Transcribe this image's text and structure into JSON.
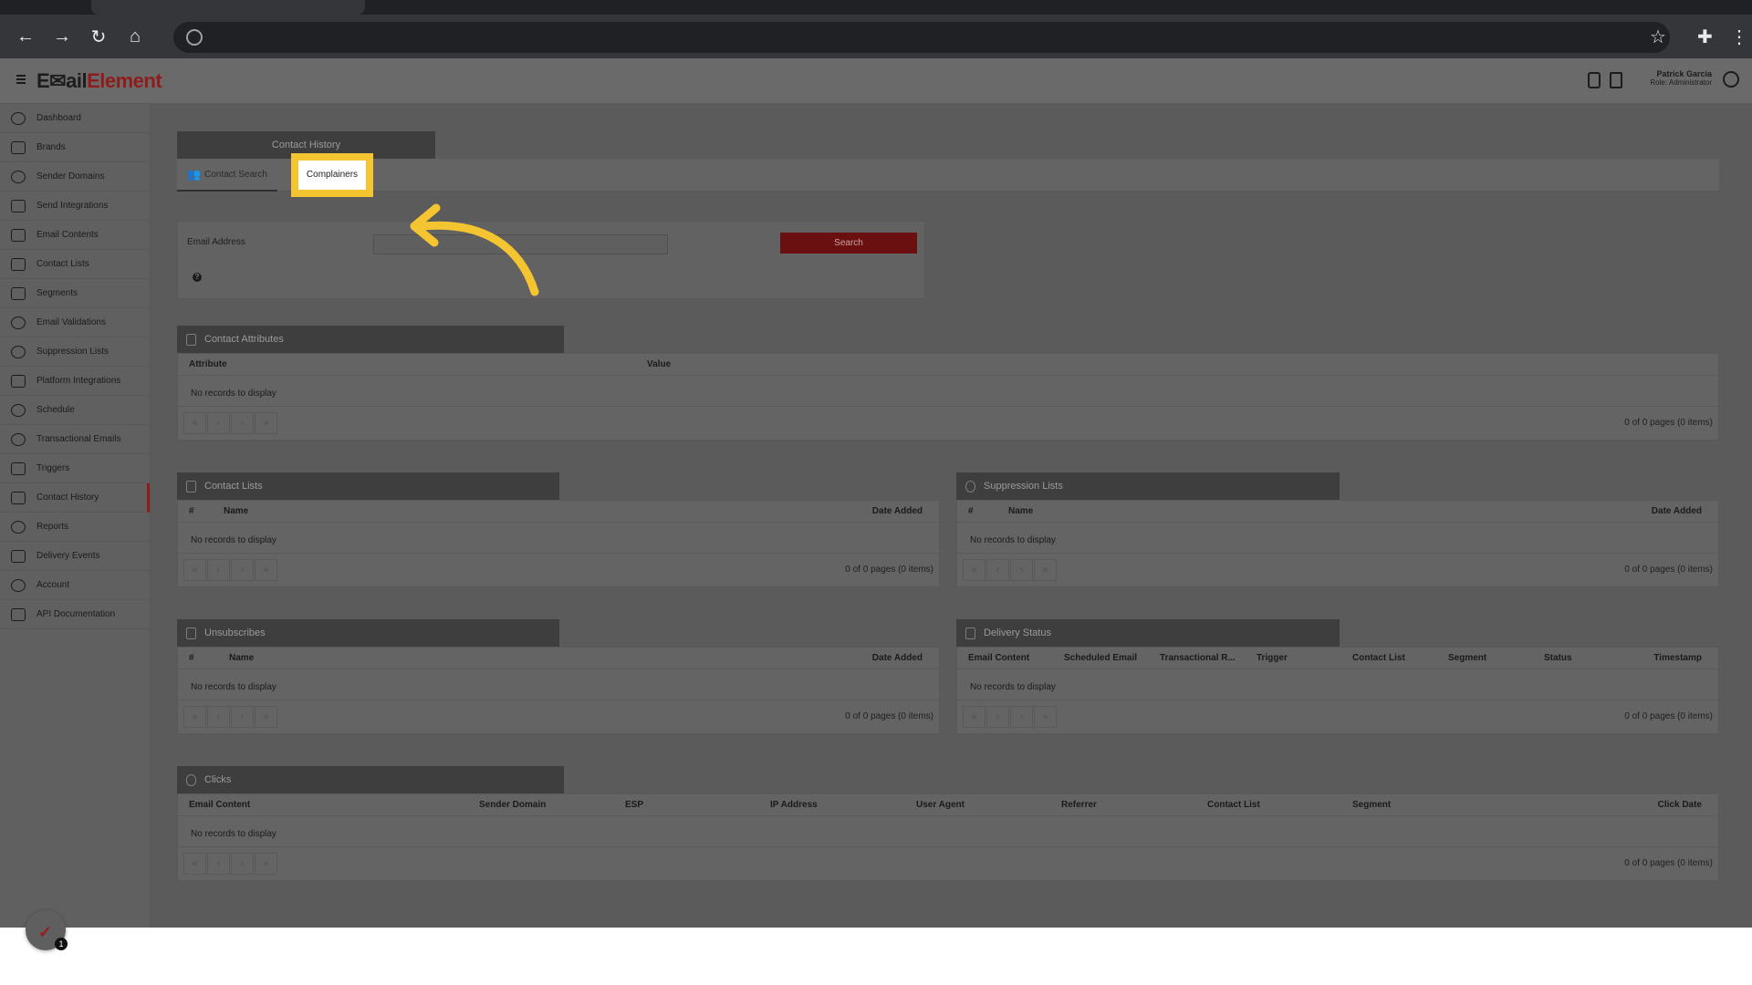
{
  "browser": {
    "omnibox_text": "",
    "icons": [
      "back-icon",
      "forward-icon",
      "reload-icon",
      "home-icon",
      "globe-icon",
      "star-icon",
      "extensions-icon",
      "menu-icon"
    ]
  },
  "app": {
    "logo_part1": "EmailElement",
    "logo_dark": "E✉ail",
    "logo_red": "Element",
    "user_name": "Patrick Garcia",
    "user_role": "Role: Administrator",
    "brand_color": "#8f1c1c"
  },
  "sidebar": {
    "items": [
      {
        "label": "Dashboard",
        "icon": "dashboard-icon"
      },
      {
        "label": "Brands",
        "icon": "brands-icon"
      },
      {
        "label": "Sender Domains",
        "icon": "globe-icon"
      },
      {
        "label": "Send Integrations",
        "icon": "wrench-icon"
      },
      {
        "label": "Email Contents",
        "icon": "envelope-icon"
      },
      {
        "label": "Contact Lists",
        "icon": "list-icon"
      },
      {
        "label": "Segments",
        "icon": "segments-icon"
      },
      {
        "label": "Email Validations",
        "icon": "check-circle-icon"
      },
      {
        "label": "Suppression Lists",
        "icon": "alert-icon"
      },
      {
        "label": "Platform Integrations",
        "icon": "tag-icon"
      },
      {
        "label": "Schedule",
        "icon": "clock-icon"
      },
      {
        "label": "Transactional Emails",
        "icon": "at-icon"
      },
      {
        "label": "Triggers",
        "icon": "lightning-icon"
      },
      {
        "label": "Contact History",
        "icon": "history-icon"
      },
      {
        "label": "Reports",
        "icon": "pie-icon"
      },
      {
        "label": "Delivery Events",
        "icon": "bar-chart-icon"
      },
      {
        "label": "Account",
        "icon": "user-icon"
      },
      {
        "label": "API Documentation",
        "icon": "document-icon"
      }
    ],
    "fab_badge": "1"
  },
  "contact_history": {
    "title": "Contact History",
    "tab_contact_search": "Contact Search",
    "tab_complainers": "Complainers"
  },
  "search": {
    "email_label": "Email Address",
    "email_value": "",
    "button": "Search",
    "help": "?"
  },
  "panels": {
    "empty": "No records to display",
    "pager_info": "0 of 0 pages (0 items)",
    "pager_first": "«",
    "pager_prev": "‹",
    "pager_next": "›",
    "pager_last": "»",
    "contact_attributes": {
      "title": "Contact Attributes",
      "columns": [
        "Attribute",
        "Value"
      ]
    },
    "contact_lists": {
      "title": "Contact Lists",
      "columns": [
        "#",
        "Name",
        "Date Added"
      ]
    },
    "suppression_lists": {
      "title": "Suppression Lists",
      "columns": [
        "#",
        "Name",
        "Date Added"
      ]
    },
    "unsubscribes": {
      "title": "Unsubscribes",
      "columns": [
        "#",
        "Name",
        "Date Added"
      ]
    },
    "delivery_status": {
      "title": "Delivery Status",
      "columns": [
        "Email Content",
        "Scheduled Email",
        "Transactional R...",
        "Trigger",
        "Contact List",
        "Segment",
        "Status",
        "Timestamp"
      ]
    },
    "clicks": {
      "title": "Clicks",
      "columns": [
        "Email Content",
        "Sender Domain",
        "ESP",
        "IP Address",
        "User Agent",
        "Referrer",
        "Contact List",
        "Segment",
        "Click Date"
      ]
    }
  },
  "annotation_color": "#f4c531"
}
